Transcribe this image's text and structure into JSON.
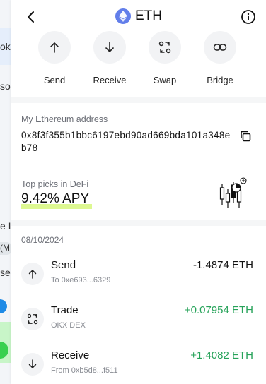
{
  "header": {
    "title": "ETH",
    "info_icon": "info-icon",
    "back_icon": "chevron-left-icon"
  },
  "actions": [
    {
      "label": "Send",
      "icon": "arrow-up-icon"
    },
    {
      "label": "Receive",
      "icon": "arrow-down-icon"
    },
    {
      "label": "Swap",
      "icon": "swap-icon"
    },
    {
      "label": "Bridge",
      "icon": "bridge-icon"
    }
  ],
  "address": {
    "label": "My Ethereum address",
    "value": "0x8f3f355b1bbc6197ebd90ad669bda101a348eb78"
  },
  "defi": {
    "label": "Top picks in DeFi",
    "apy": "9.42% APY",
    "accent": "#d7f77e"
  },
  "history": {
    "date": "08/10/2024",
    "transactions": [
      {
        "type": "Send",
        "sub": "To 0xe693...6329",
        "amount": "-1.4874 ETH",
        "direction": "out",
        "icon": "arrow-up-icon"
      },
      {
        "type": "Trade",
        "sub": "OKX DEX",
        "amount": "+0.07954 ETH",
        "direction": "in",
        "icon": "swap-icon"
      },
      {
        "type": "Receive",
        "sub": "From 0xb5d8...f511",
        "amount": "+1.4082 ETH",
        "direction": "in",
        "icon": "arrow-down-icon"
      }
    ]
  },
  "background_app": {
    "fragments": [
      "oke",
      "so",
      "e In",
      "(M",
      "se"
    ]
  },
  "colors": {
    "eth": "#627eea",
    "positive": "#27a35a",
    "negative": "#111111"
  }
}
